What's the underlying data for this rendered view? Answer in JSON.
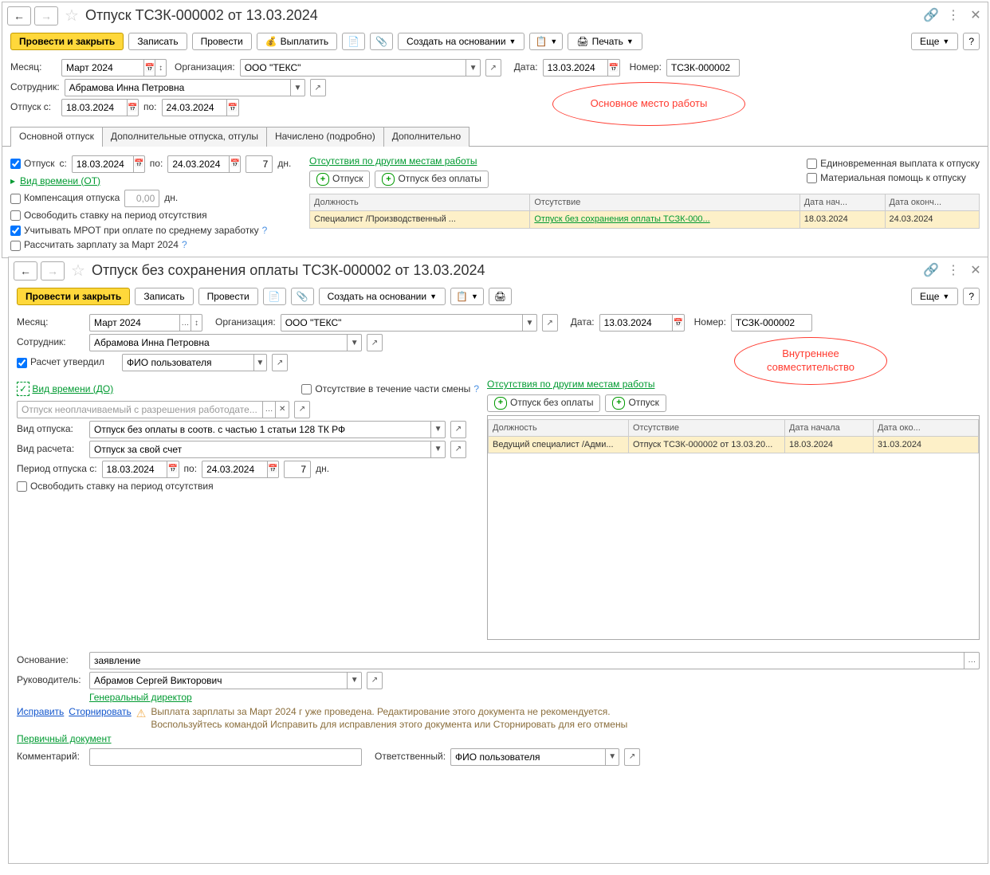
{
  "win1": {
    "title": "Отпуск ТСЗК-000002 от 13.03.2024",
    "callout": "Основное место работы",
    "toolbar": {
      "post_close": "Провести и закрыть",
      "save": "Записать",
      "post": "Провести",
      "pay": "Выплатить",
      "create_based": "Создать на основании",
      "print": "Печать",
      "more": "Еще"
    },
    "fields": {
      "month_lbl": "Месяц:",
      "month": "Март 2024",
      "org_lbl": "Организация:",
      "org": "ООО \"ТЕКС\"",
      "date_lbl": "Дата:",
      "date": "13.03.2024",
      "num_lbl": "Номер:",
      "num": "ТСЗК-000002",
      "emp_lbl": "Сотрудник:",
      "emp": "Абрамова Инна Петровна",
      "from_lbl": "Отпуск с:",
      "from": "18.03.2024",
      "to_lbl": "по:",
      "to": "24.03.2024"
    },
    "tabs": [
      "Основной отпуск",
      "Дополнительные отпуска, отгулы",
      "Начислено (подробно)",
      "Дополнительно"
    ],
    "left_pane": {
      "vac_chk": "Отпуск",
      "from_lbl": "с:",
      "from": "18.03.2024",
      "to_lbl": "по:",
      "to": "24.03.2024",
      "days": "7",
      "days_unit": "дн.",
      "kind_link": "Вид времени (ОТ)",
      "comp_chk": "Компенсация отпуска",
      "comp_val": "0,00",
      "comp_unit": "дн.",
      "release_chk": "Освободить ставку на период отсутствия",
      "mrot_chk": "Учитывать МРОТ при оплате по среднему заработку",
      "calc_chk": "Рассчитать зарплату за Март 2024"
    },
    "right_pane": {
      "title": "Отсутствия по другим местам работы",
      "btn1": "Отпуск",
      "btn2": "Отпуск без оплаты",
      "lump_chk": "Единовременная выплата к отпуску",
      "mat_chk": "Материальная помощь к отпуску",
      "cols": [
        "Должность",
        "Отсутствие",
        "Дата нач...",
        "Дата оконч..."
      ],
      "row": {
        "pos": "Специалист /Производственный ...",
        "abs": "Отпуск без сохранения оплаты ТСЗК-000...",
        "d1": "18.03.2024",
        "d2": "24.03.2024"
      }
    }
  },
  "win2": {
    "title": "Отпуск без сохранения оплаты ТСЗК-000002 от 13.03.2024",
    "callout": "Внутреннее совместительство",
    "toolbar": {
      "post_close": "Провести и закрыть",
      "save": "Записать",
      "post": "Провести",
      "create_based": "Создать на основании",
      "more": "Еще"
    },
    "fields": {
      "month_lbl": "Месяц:",
      "month": "Март 2024",
      "org_lbl": "Организация:",
      "org": "ООО \"ТЕКС\"",
      "date_lbl": "Дата:",
      "date": "13.03.2024",
      "num_lbl": "Номер:",
      "num": "ТСЗК-000002",
      "emp_lbl": "Сотрудник:",
      "emp": "Абрамова Инна Петровна",
      "approved_chk": "Расчет утвердил",
      "approved_by": "ФИО пользователя",
      "kind_link": "Вид времени (ДО)",
      "kind_placeholder": "Отпуск неоплачиваемый с разрешения работодате...",
      "part_shift_chk": "Отсутствие в течение части смены",
      "vac_type_lbl": "Вид отпуска:",
      "vac_type": "Отпуск без оплаты в соотв. с частью 1 статьи 128 ТК РФ",
      "calc_type_lbl": "Вид расчета:",
      "calc_type": "Отпуск за свой счет",
      "period_lbl": "Период отпуска с:",
      "from": "18.03.2024",
      "to_lbl": "по:",
      "to": "24.03.2024",
      "days": "7",
      "days_unit": "дн.",
      "release_chk": "Освободить ставку на период отсутствия"
    },
    "right_pane": {
      "title": "Отсутствия по другим местам работы",
      "btn1": "Отпуск без оплаты",
      "btn2": "Отпуск",
      "cols": [
        "Должность",
        "Отсутствие",
        "Дата начала",
        "Дата око..."
      ],
      "row": {
        "pos": "Ведущий специалист /Адми...",
        "abs": "Отпуск ТСЗК-000002 от 13.03.20...",
        "d1": "18.03.2024",
        "d2": "31.03.2024"
      }
    },
    "footer": {
      "basis_lbl": "Основание:",
      "basis": "заявление",
      "mgr_lbl": "Руководитель:",
      "mgr": "Абрамов Сергей Викторович",
      "mgr_pos": "Генеральный директор",
      "fix_link": "Исправить",
      "storno_link": "Сторнировать",
      "warn1": "Выплата зарплаты за Март 2024 г уже проведена. Редактирование этого документа не рекомендуется.",
      "warn2": "Воспользуйтесь командой Исправить для исправления этого документа или Сторнировать для его отмены",
      "prim_link": "Первичный документ",
      "comment_lbl": "Комментарий:",
      "resp_lbl": "Ответственный:",
      "resp": "ФИО пользователя"
    }
  }
}
